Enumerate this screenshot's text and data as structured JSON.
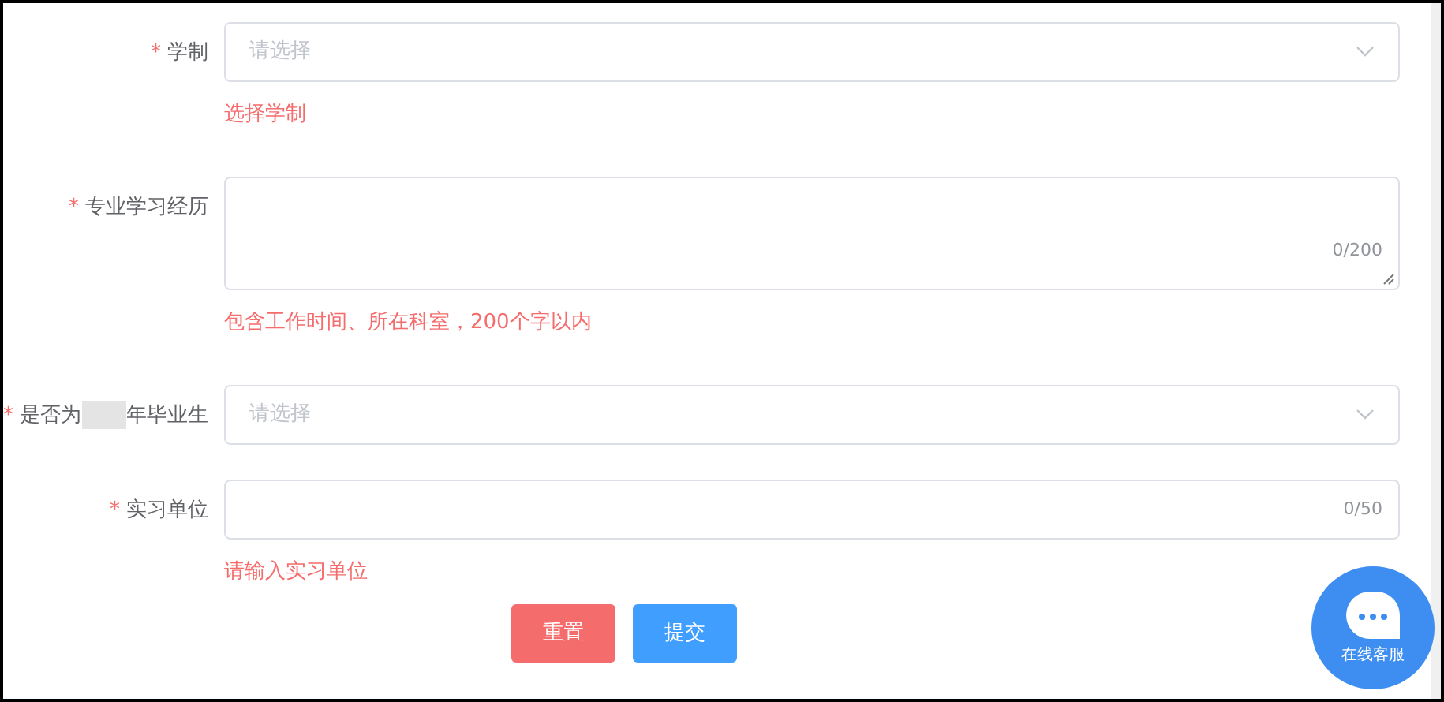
{
  "fields": [
    {
      "kind": "select",
      "required_mark": "*",
      "label_parts": [
        "学制"
      ],
      "placeholder": "请选择",
      "hint": "选择学制"
    },
    {
      "kind": "textarea",
      "required_mark": "*",
      "label_parts": [
        "专业学习经历"
      ],
      "counter": "0/200",
      "hint": "包含工作时间、所在科室，200个字以内"
    },
    {
      "kind": "select",
      "required_mark": "*",
      "label_parts": [
        "是否为",
        "年毕业生"
      ],
      "placeholder": "请选择"
    },
    {
      "kind": "input",
      "required_mark": "*",
      "label_parts": [
        "实习单位"
      ],
      "counter": "0/50",
      "hint": "请输入实习单位"
    }
  ],
  "buttons": [
    {
      "label": "重置",
      "kind": "reset"
    },
    {
      "label": "提交",
      "kind": "submit"
    }
  ],
  "chat_widget": {
    "label": "在线客服"
  }
}
